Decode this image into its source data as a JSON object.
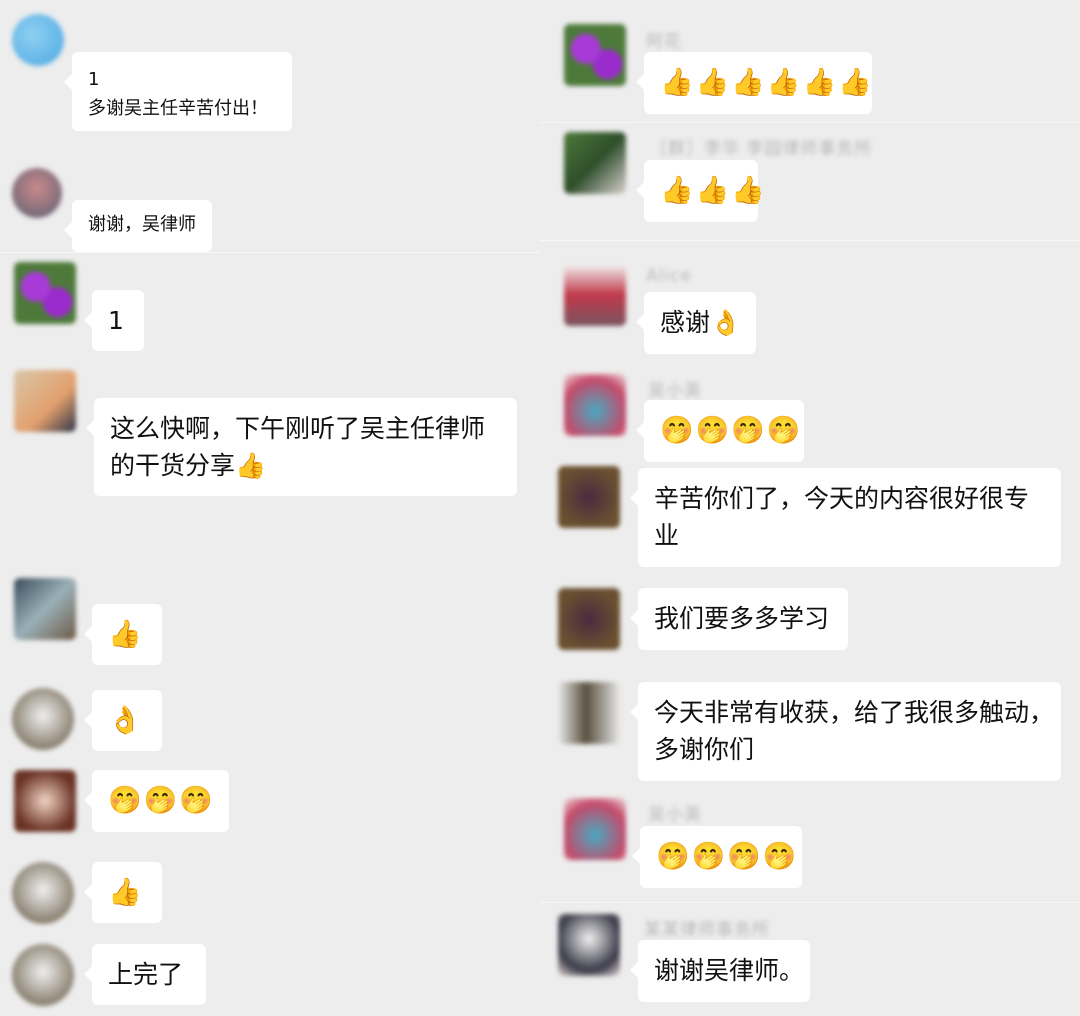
{
  "left_column": {
    "messages": [
      {
        "text_line1": "1",
        "text_line2": "多谢吴主任辛苦付出！"
      },
      {
        "text": "谢谢，吴律师"
      },
      {
        "text": "1"
      },
      {
        "text_line1": "这么快啊，下午刚听了吴主任律师",
        "text_line2": "的干货分享👍"
      },
      {
        "text": "👍"
      },
      {
        "text": "👌"
      },
      {
        "text": "🤭🤭🤭"
      },
      {
        "text": "👍"
      },
      {
        "text": "上完了"
      }
    ]
  },
  "right_column": {
    "messages": [
      {
        "sender": "阿花",
        "text": "👍👍👍👍👍👍"
      },
      {
        "sender": "［群］李华 李园律师事务所",
        "text": "👍👍👍"
      },
      {
        "sender": "Alice",
        "text": "感谢👌"
      },
      {
        "sender": "吴小英",
        "text": "🤭🤭🤭🤭"
      },
      {
        "text_line1": "辛苦你们了，今天的内容很好很专",
        "text_line2": "业"
      },
      {
        "text": "我们要多多学习"
      },
      {
        "text_line1": "今天非常有收获，给了我很多触动，",
        "text_line2": "多谢你们"
      },
      {
        "sender": "吴小英",
        "text": "🤭🤭🤭🤭"
      },
      {
        "sender": "某某律师事务所",
        "text": "谢谢吴律师。"
      }
    ]
  },
  "colors": {
    "background": "#ededed",
    "bubble": "#ffffff",
    "text": "#111111"
  }
}
